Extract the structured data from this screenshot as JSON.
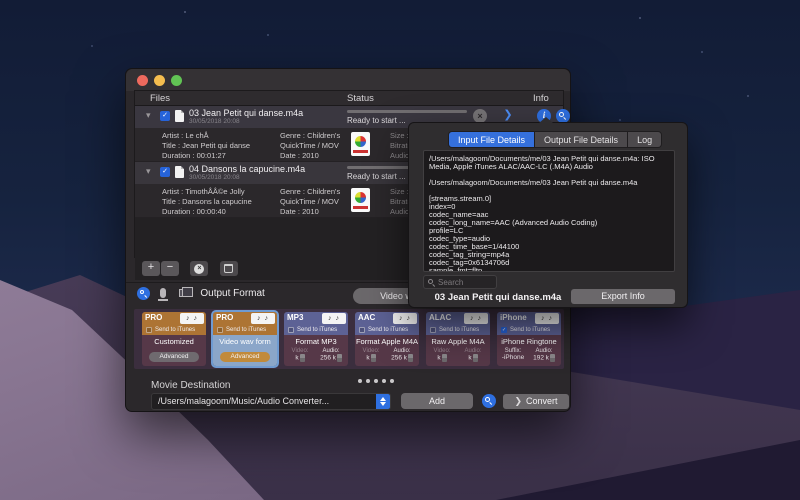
{
  "window": {
    "columns": {
      "files": "Files",
      "status": "Status",
      "info": "Info"
    },
    "files": [
      {
        "name": "03 Jean Petit qui danse.m4a",
        "date": "30/05/2018 20:08",
        "status": "Ready to start ...",
        "artist": "Artist : Le chÅ",
        "title": "Title : Jean Petit qui danse",
        "duration": "Duration : 00:01:27",
        "genre": "Genre : Children's",
        "container": "QuickTime / MOV",
        "year": "Date : 2010",
        "size": "Size :",
        "bitrate": "Bitrate :",
        "audio": "Audio :"
      },
      {
        "name": "04 Dansons la capucine.m4a",
        "date": "30/05/2018 20:08",
        "status": "Ready to start ...",
        "artist": "Artist : TimothÅÅ©e Jolly",
        "title": "Title : Dansons la capucine",
        "duration": "Duration : 00:00:40",
        "genre": "Genre : Children's",
        "container": "QuickTime / MOV",
        "year": "Date : 2010",
        "size": "Size :",
        "bitrate": "Bitrate :",
        "audio": "Audio :"
      }
    ],
    "toolbar": {
      "add": "+",
      "remove": "−"
    },
    "output": {
      "label": "Output Format",
      "preset_button": "Video wav form",
      "send_to_itunes": "Send to iTunes",
      "cards": [
        {
          "badge": "PRO",
          "name": "Customized",
          "action": "Advanced"
        },
        {
          "badge": "PRO",
          "name": "Video wav form",
          "action": "Advanced"
        },
        {
          "badge": "MP3",
          "name": "Format MP3",
          "video_label": "Video:",
          "video_value": "",
          "video_unit": "k",
          "audio_label": "Audio:",
          "audio_value": "256",
          "audio_unit": "k"
        },
        {
          "badge": "AAC",
          "name": "Format Apple M4A",
          "video_label": "Video:",
          "video_value": "",
          "video_unit": "k",
          "audio_label": "Audio:",
          "audio_value": "256",
          "audio_unit": "k"
        },
        {
          "badge": "ALAC",
          "name": "Raw Apple M4A",
          "video_label": "Video:",
          "video_value": "",
          "video_unit": "k",
          "audio_label": "Audio:",
          "audio_value": "",
          "audio_unit": "k"
        },
        {
          "badge": "iPhone",
          "name": "iPhone Ringtone",
          "suffix_label": "Suffix:",
          "suffix_value": "-iPhone",
          "audio_label": "Audio:",
          "audio_value": "192",
          "audio_unit": "k"
        }
      ]
    },
    "destination": {
      "label": "Movie Destination",
      "path": "/Users/malagoom/Music/Audio Converter...",
      "add": "Add",
      "convert": "Convert"
    }
  },
  "panel": {
    "tabs": [
      "Input File Details",
      "Output File Details",
      "Log"
    ],
    "active_tab": "Input File Details",
    "details": "/Users/malagoom/Documents/me/03 Jean Petit qui danse.m4a: ISO Media, Apple iTunes ALAC/AAC-LC (.M4A) Audio\n\n/Users/malagoom/Documents/me/03 Jean Petit qui danse.m4a\n\n[streams.stream.0]\nindex=0\ncodec_name=aac\ncodec_long_name=AAC (Advanced Audio Coding)\nprofile=LC\ncodec_type=audio\ncodec_time_base=1/44100\ncodec_tag_string=mp4a\ncodec_tag=0x6134706d\nsample_fmt=fltp",
    "search_placeholder": "Search",
    "file_name": "03 Jean Petit qui danse.m4a",
    "export": "Export Info"
  },
  "icons": {
    "notes": "♪ ♪",
    "info": "i",
    "play": "❯",
    "cancel": "×",
    "check": "✓",
    "disclosure": "▾",
    "convert_chevron": "❯"
  },
  "colors": {
    "accent_blue": "#2e6fe0",
    "checkbox_blue": "#2663d9",
    "pro_orange": "#ad7434",
    "format_blue": "#5d6295",
    "card_body": "#563848",
    "selected_border": "#6f9bd2",
    "traffic_red": "#ee6a5e",
    "traffic_yellow": "#f5bd4f",
    "traffic_green": "#61c354"
  }
}
